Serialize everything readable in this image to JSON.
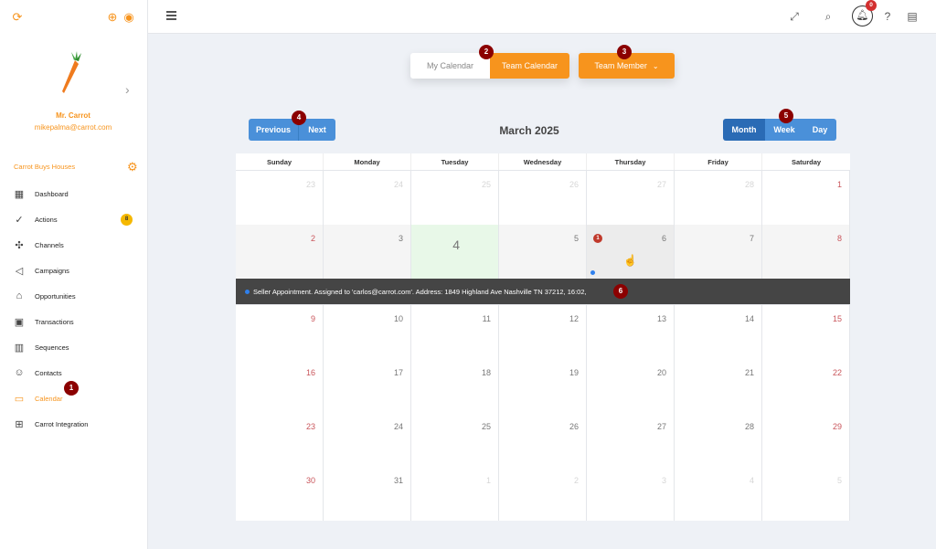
{
  "sidebar": {
    "user_name": "Mr. Carrot",
    "user_email": "mikepalma@carrot.com",
    "org_name": "Carrot Buys Houses",
    "items": [
      {
        "label": "Dashboard",
        "icon": "dashboard-icon"
      },
      {
        "label": "Actions",
        "icon": "check-circle-icon",
        "badge": "8"
      },
      {
        "label": "Channels",
        "icon": "puzzle-icon"
      },
      {
        "label": "Campaigns",
        "icon": "megaphone-icon"
      },
      {
        "label": "Opportunities",
        "icon": "house-icon"
      },
      {
        "label": "Transactions",
        "icon": "money-icon"
      },
      {
        "label": "Sequences",
        "icon": "columns-icon"
      },
      {
        "label": "Contacts",
        "icon": "people-icon"
      },
      {
        "label": "Calendar",
        "icon": "calendar-icon",
        "active": true
      },
      {
        "label": "Carrot Integration",
        "icon": "chip-icon"
      }
    ]
  },
  "topbar": {
    "notification_count": "0"
  },
  "toolbar": {
    "my_calendar": "My Calendar",
    "team_calendar": "Team Calendar",
    "team_member": "Team Member",
    "previous": "Previous",
    "next": "Next",
    "month_title": "March 2025",
    "view_month": "Month",
    "view_week": "Week",
    "view_day": "Day"
  },
  "calendar": {
    "weekdays": [
      "Sunday",
      "Monday",
      "Tuesday",
      "Wednesday",
      "Thursday",
      "Friday",
      "Saturday"
    ],
    "weeks": [
      [
        "23",
        "24",
        "25",
        "26",
        "27",
        "28",
        "1"
      ],
      [
        "2",
        "3",
        "4",
        "5",
        "6",
        "7",
        "8"
      ],
      [
        "9",
        "10",
        "11",
        "12",
        "13",
        "14",
        "15"
      ],
      [
        "16",
        "17",
        "18",
        "19",
        "20",
        "21",
        "22"
      ],
      [
        "23",
        "24",
        "25",
        "26",
        "27",
        "28",
        "29"
      ],
      [
        "30",
        "31",
        "1",
        "2",
        "3",
        "4",
        "5"
      ]
    ],
    "event_count_day6": "1",
    "event_text": "Seller Appointment. Assigned to 'carlos@carrot.com'. Address: 1849 Highland Ave Nashville TN 37212, 16:02,"
  },
  "markers": [
    "1",
    "2",
    "3",
    "4",
    "5",
    "6"
  ],
  "colors": {
    "brand_orange": "#f7941d",
    "button_blue": "#4a90d9",
    "active_blue": "#2a6bb5",
    "marker_red": "#8b0000",
    "today_green": "#e8f8e8"
  }
}
